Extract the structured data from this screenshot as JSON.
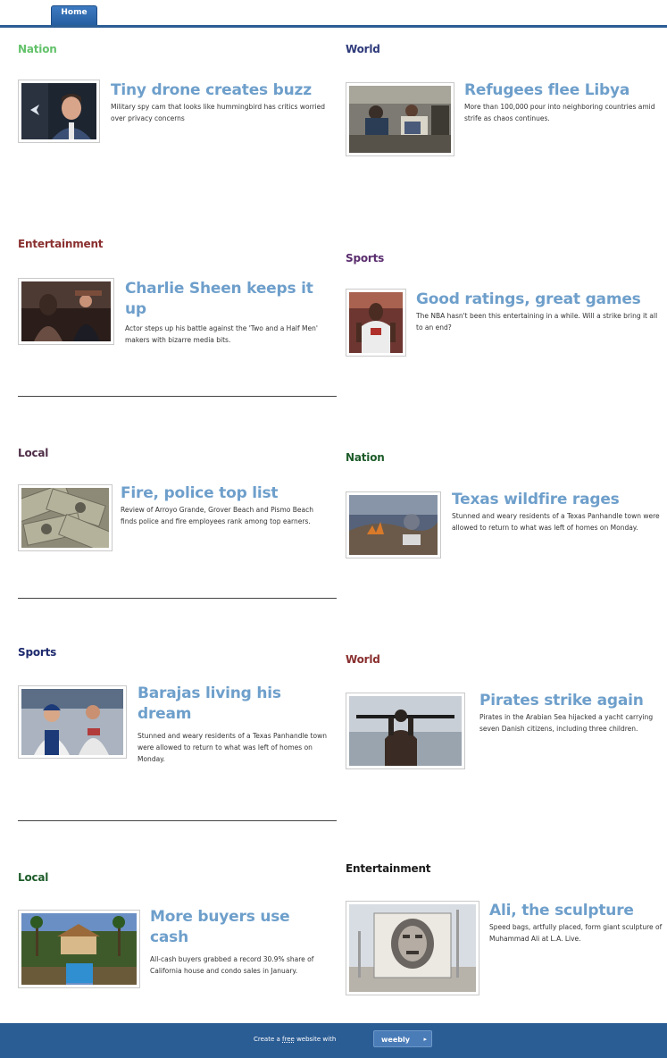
{
  "nav": {
    "home_tab": "Home"
  },
  "colors": {
    "accent": "#2b5d95",
    "headline": "#6e9fcb",
    "nation": "#63c26a",
    "world": "#2e3a7a",
    "entertainment": "#8a2f2f",
    "sports": "#5a2d6e",
    "local": "#4e2d47"
  },
  "stories": [
    {
      "category": "Nation",
      "headline": "Tiny drone creates buzz",
      "desc": "Military spy cam that looks like hummingbird has critics worried over privacy concerns",
      "thumb_icon": "man-portrait-icon"
    },
    {
      "category": "World",
      "headline": "Refugees flee Libya",
      "desc": "More than 100,000 pour into neighboring countries amid strife as chaos continues.",
      "thumb_icon": "refugees-photo-icon"
    },
    {
      "category": "Entertainment",
      "headline": "Charlie Sheen keeps it up",
      "desc": "Actor steps up his battle against the 'Two and a Half Men' makers with bizarre media bits.",
      "thumb_icon": "interview-photo-icon"
    },
    {
      "category": "Sports",
      "headline": "Good ratings, great games",
      "desc": "The NBA hasn't been this entertaining in a while. Will a strike bring it all to an end?",
      "thumb_icon": "basketball-player-icon"
    },
    {
      "category": "Local",
      "headline": "Fire, police top list",
      "desc": "Review of Arroyo Grande, Grover Beach and Pismo Beach finds police and fire employees rank among top earners.",
      "thumb_icon": "money-photo-icon"
    },
    {
      "category": "Nation",
      "headline": "Texas wildfire rages",
      "desc": "Stunned and weary residents of a Texas Panhandle town were allowed to return to what was left of homes on Monday.",
      "thumb_icon": "wildfire-photo-icon"
    },
    {
      "category": "Sports",
      "headline": "Barajas living his dream",
      "desc": "Stunned and weary residents of a Texas Panhandle town were allowed to return to what was left of homes on Monday.",
      "thumb_icon": "baseball-players-icon"
    },
    {
      "category": "World",
      "headline": "Pirates strike again",
      "desc": "Pirates in the Arabian Sea hijacked a yacht carrying seven Danish citizens, including three children.",
      "thumb_icon": "pirate-silhouette-icon"
    },
    {
      "category": "Local",
      "headline": "More buyers use cash",
      "desc": "All-cash buyers grabbed a record 30.9% share of California house and condo sales in January.",
      "thumb_icon": "mansion-pool-icon"
    },
    {
      "category": "Entertainment",
      "headline": "Ali, the sculpture",
      "desc": "Speed bags, artfully placed, form giant sculpture of Muhammad Ali at L.A. Live.",
      "thumb_icon": "ali-sculpture-icon"
    }
  ],
  "footer": {
    "prefix": "Create a",
    "free": "free",
    "suffix": "website with",
    "button": "weebly",
    "arrow": "▸"
  }
}
